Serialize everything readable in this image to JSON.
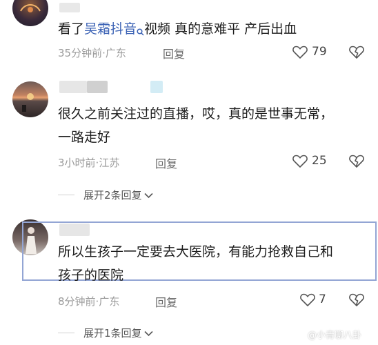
{
  "comments": [
    {
      "text_before": "看了",
      "link_text": "吴霜抖音",
      "text_after": "视频  真的意难平  产后出血",
      "time": "35分钟前",
      "location": "广东",
      "reply_label": "回复",
      "likes": "79"
    },
    {
      "line1": "很久之前关注过的直播，哎，真的是世事无常，",
      "line2": "一路走好",
      "time": "3小时前",
      "location": "江苏",
      "reply_label": "回复",
      "likes": "25",
      "expand_label": "展开2条回复"
    },
    {
      "line1": "所以生孩子一定要去大医院，有能力抢救自己和",
      "line2": "孩子的医院",
      "time": "8分钟前",
      "location": "广东",
      "reply_label": "回复",
      "likes": "7",
      "expand_label": "展开1条回复"
    }
  ],
  "separator": "·",
  "watermark": "@小青聊八卦",
  "colors": {
    "link": "#3b62b5",
    "meta": "#9a9a9a",
    "highlight": "#93a5d4"
  },
  "icons": [
    "heart-outline-icon",
    "dislike-heart-icon",
    "search-icon",
    "chevron-down-icon"
  ]
}
